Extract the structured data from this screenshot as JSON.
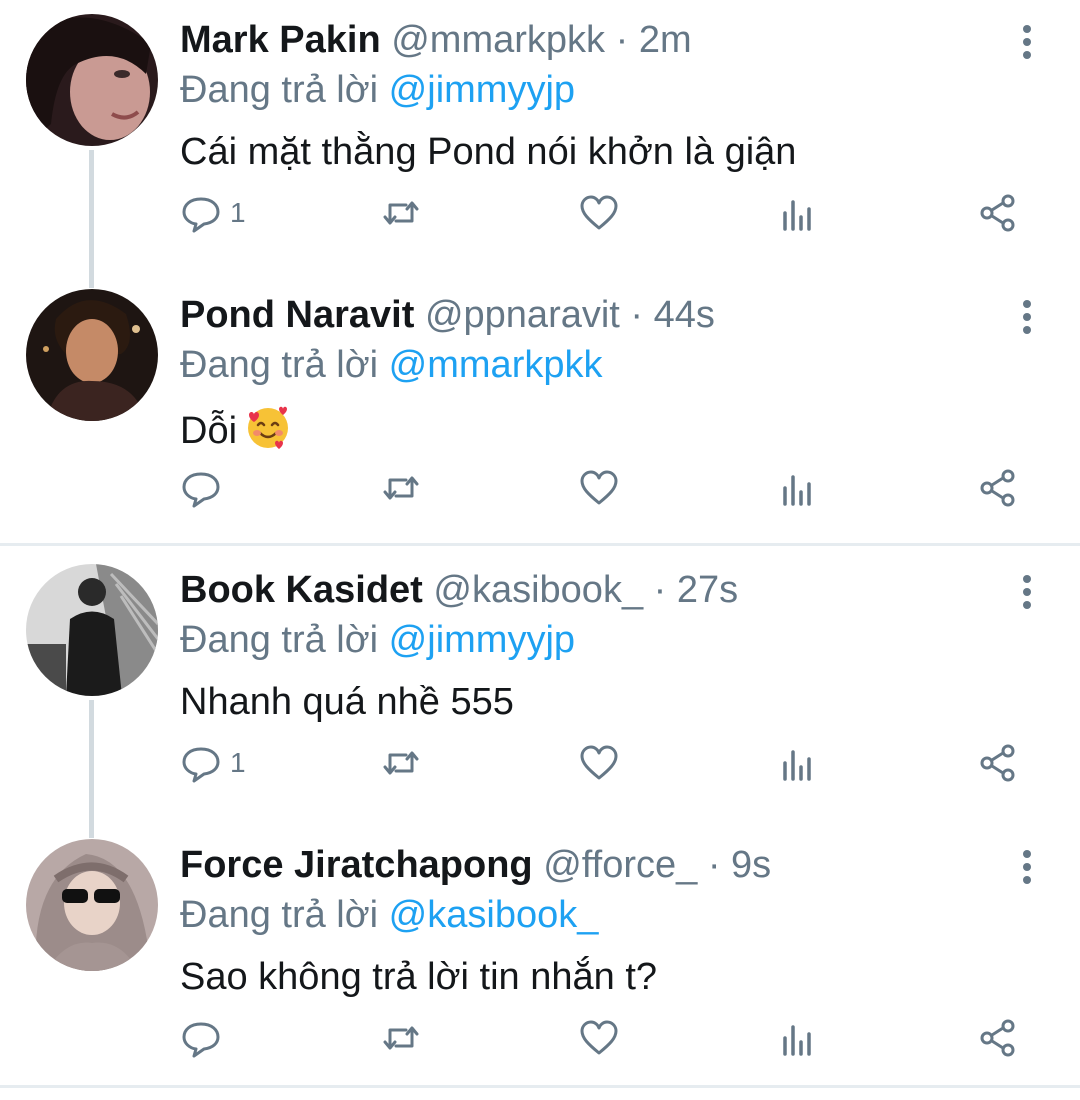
{
  "reply_prefix": "Đang trả lời",
  "tweets": [
    {
      "name": "Mark Pakin",
      "handle": "@mmarkpkk",
      "time": "2m",
      "reply_to": "@jimmyyjp",
      "text": "Cái mặt thằng Pond nói khởn là giận",
      "reply_count": "1"
    },
    {
      "name": "Pond Naravit",
      "handle": "@ppnaravit",
      "time": "44s",
      "reply_to": "@mmarkpkk",
      "text": "Dỗi",
      "emoji": "smiling-face-with-hearts",
      "reply_count": ""
    },
    {
      "name": "Book Kasidet",
      "handle": "@kasibook_",
      "time": "27s",
      "reply_to": "@jimmyyjp",
      "text": "Nhanh quá nhề 555",
      "reply_count": "1"
    },
    {
      "name": "Force Jiratchapong",
      "handle": "@fforce_",
      "time": "9s",
      "reply_to": "@kasibook_",
      "text": "Sao không trả lời tin nhắn t?",
      "reply_count": ""
    }
  ],
  "colors": {
    "name": "#14171a",
    "secondary": "#657786",
    "mention": "#1da1f2",
    "thread_line": "#d2dadf"
  }
}
